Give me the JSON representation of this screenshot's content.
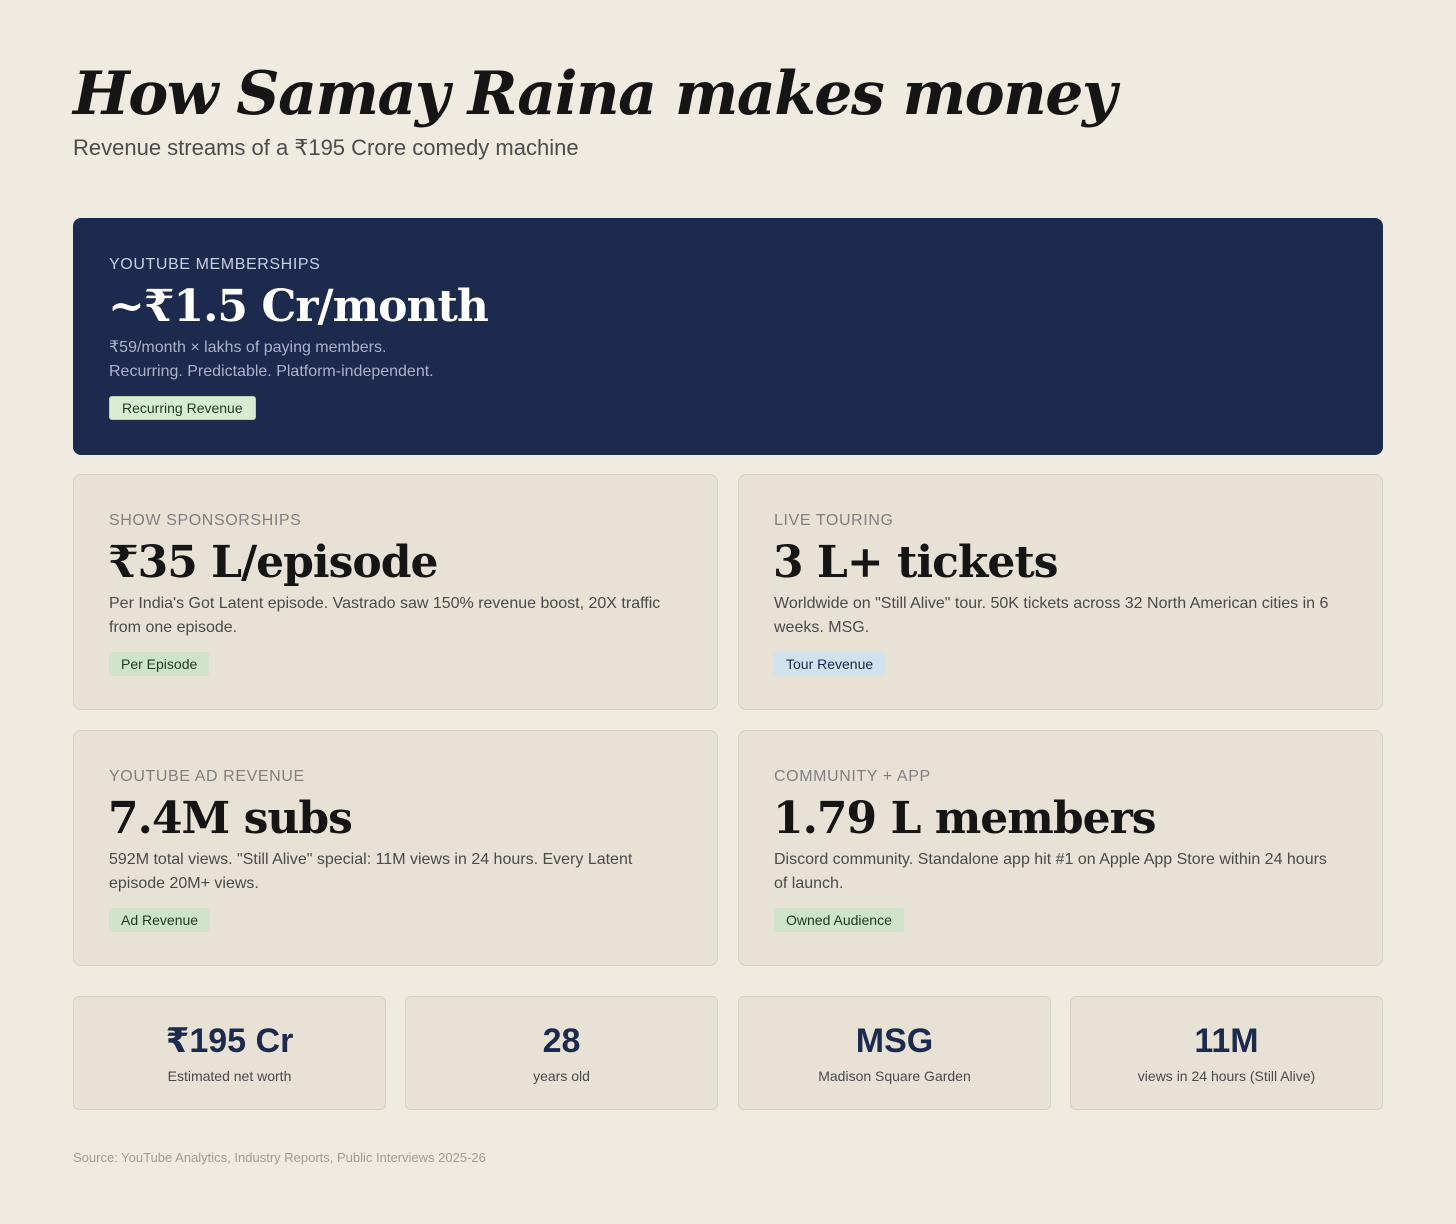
{
  "header": {
    "title": "How Samay Raina makes money",
    "subtitle": "Revenue streams of a ₹195 Crore comedy machine"
  },
  "hero": {
    "label": "YOUTUBE MEMBERSHIPS",
    "value": "~₹1.5 Cr/month",
    "desc_line1": "₹59/month × lakhs of paying members.",
    "desc_line2": "Recurring. Predictable. Platform-independent.",
    "tag": "Recurring Revenue"
  },
  "streams": [
    {
      "label": "SHOW SPONSORSHIPS",
      "value": "₹35 L/episode",
      "desc": "Per India's Got Latent episode. Vastrado saw 150% revenue boost, 20X traffic from one episode.",
      "tag": "Per Episode"
    },
    {
      "label": "LIVE TOURING",
      "value": "3 L+ tickets",
      "desc": "Worldwide on \"Still Alive\" tour. 50K tickets across 32 North American cities in 6 weeks. MSG.",
      "tag": "Tour Revenue"
    },
    {
      "label": "YOUTUBE AD REVENUE",
      "value": "7.4M subs",
      "desc": "592M total views. \"Still Alive\" special: 11M views in 24 hours. Every Latent episode 20M+ views.",
      "tag": "Ad Revenue"
    },
    {
      "label": "COMMUNITY + APP",
      "value": "1.79 L members",
      "desc": "Discord community. Standalone app hit #1 on Apple App Store within 24 hours of launch.",
      "tag": "Owned Audience"
    }
  ],
  "stats": [
    {
      "value": "₹195 Cr",
      "label": "Estimated net worth"
    },
    {
      "value": "28",
      "label": "years old"
    },
    {
      "value": "MSG",
      "label": "Madison Square Garden"
    },
    {
      "value": "11M",
      "label": "views in 24 hours (Still Alive)"
    }
  ],
  "footer": {
    "source": "Source: YouTube Analytics, Industry Reports, Public Interviews 2025-26"
  },
  "colors": {
    "background": "#efebe1",
    "hero_background": "#1c2a4e",
    "card_background": "#e7e1d6",
    "tag_green": "#cfe3c9",
    "tag_blue": "#d2e1ee",
    "stat_value": "#1c2a4e"
  }
}
